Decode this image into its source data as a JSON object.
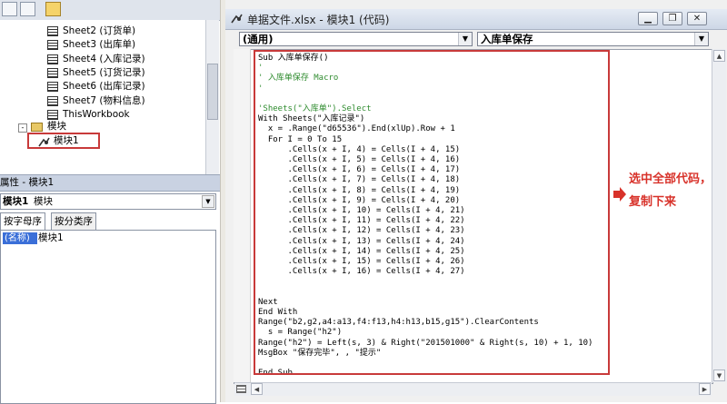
{
  "project_tree": {
    "items": [
      {
        "label": "Sheet2 (订货单)",
        "type": "sheet"
      },
      {
        "label": "Sheet3 (出库单)",
        "type": "sheet"
      },
      {
        "label": "Sheet4 (入库记录)",
        "type": "sheet"
      },
      {
        "label": "Sheet5 (订货记录)",
        "type": "sheet"
      },
      {
        "label": "Sheet6 (出库记录)",
        "type": "sheet"
      },
      {
        "label": "Sheet7 (物料信息)",
        "type": "sheet"
      },
      {
        "label": "ThisWorkbook",
        "type": "workbook"
      }
    ],
    "modules_folder": "模块",
    "module_item": "模块1"
  },
  "properties": {
    "title": "属性 - 模块1",
    "combo_value": "模块1",
    "combo_type": "模块",
    "tabs": [
      "按字母序",
      "按分类序"
    ],
    "row_name": "(名称)",
    "row_value": "模块1"
  },
  "code_window": {
    "title": "单据文件.xlsx - 模块1 (代码)",
    "object_combo": "(通用)",
    "proc_combo": "入库单保存",
    "lines": [
      {
        "t": "Sub 入库单保存()",
        "c": false
      },
      {
        "t": "'",
        "c": true
      },
      {
        "t": "' 入库单保存 Macro",
        "c": true
      },
      {
        "t": "'",
        "c": true
      },
      {
        "t": "",
        "c": false
      },
      {
        "t": "'Sheets(\"入库单\").Select",
        "c": true
      },
      {
        "t": "With Sheets(\"入库记录\")",
        "c": false
      },
      {
        "t": "  x = .Range(\"d65536\").End(xlUp).Row + 1",
        "c": false
      },
      {
        "t": "  For I = 0 To 15",
        "c": false
      },
      {
        "t": "      .Cells(x + I, 4) = Cells(I + 4, 15)",
        "c": false
      },
      {
        "t": "      .Cells(x + I, 5) = Cells(I + 4, 16)",
        "c": false
      },
      {
        "t": "      .Cells(x + I, 6) = Cells(I + 4, 17)",
        "c": false
      },
      {
        "t": "      .Cells(x + I, 7) = Cells(I + 4, 18)",
        "c": false
      },
      {
        "t": "      .Cells(x + I, 8) = Cells(I + 4, 19)",
        "c": false
      },
      {
        "t": "      .Cells(x + I, 9) = Cells(I + 4, 20)",
        "c": false
      },
      {
        "t": "      .Cells(x + I, 10) = Cells(I + 4, 21)",
        "c": false
      },
      {
        "t": "      .Cells(x + I, 11) = Cells(I + 4, 22)",
        "c": false
      },
      {
        "t": "      .Cells(x + I, 12) = Cells(I + 4, 23)",
        "c": false
      },
      {
        "t": "      .Cells(x + I, 13) = Cells(I + 4, 24)",
        "c": false
      },
      {
        "t": "      .Cells(x + I, 14) = Cells(I + 4, 25)",
        "c": false
      },
      {
        "t": "      .Cells(x + I, 15) = Cells(I + 4, 26)",
        "c": false
      },
      {
        "t": "      .Cells(x + I, 16) = Cells(I + 4, 27)",
        "c": false
      },
      {
        "t": "",
        "c": false
      },
      {
        "t": "",
        "c": false
      },
      {
        "t": "Next",
        "c": false
      },
      {
        "t": "End With",
        "c": false
      },
      {
        "t": "Range(\"b2,g2,a4:a13,f4:f13,h4:h13,b15,g15\").ClearContents",
        "c": false
      },
      {
        "t": "  s = Range(\"h2\")",
        "c": false
      },
      {
        "t": "Range(\"h2\") = Left(s, 3) & Right(\"201501000\" & Right(s, 10) + 1, 10)",
        "c": false
      },
      {
        "t": "MsgBox \"保存完毕\", , \"提示\"",
        "c": false
      },
      {
        "t": "",
        "c": false
      },
      {
        "t": "End Sub",
        "c": false
      }
    ]
  },
  "annotation": {
    "line1": "选中全部代码，",
    "line2": "复制下来",
    "color": "#d8322a"
  }
}
